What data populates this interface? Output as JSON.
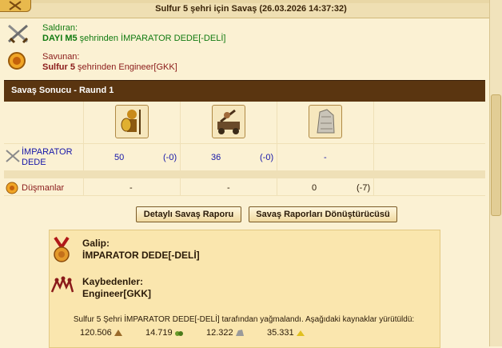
{
  "header": {
    "title": "Sulfur 5 şehri için Savaş (26.03.2026 14:37:32)"
  },
  "attacker": {
    "label": "Saldıran:",
    "name": "DAYI M5",
    "from_text": " şehrinden İMPARATOR DEDE[-DELİ]"
  },
  "defender": {
    "label": "Savunan:",
    "name": "Sulfur 5",
    "from_text": " şehrinden Engineer[GKK]"
  },
  "battle": {
    "round_title": "Savaş Sonucu - Raund 1",
    "rows": [
      {
        "name_line1": "İMPARATOR",
        "name_line2": "DEDE",
        "unit1_value": "50",
        "unit1_loss": "(-0)",
        "unit2_value": "36",
        "unit2_loss": "(-0)",
        "unit3_value": "-"
      },
      {
        "name": "Düşmanlar",
        "unit1_value": "-",
        "unit2_value": "-",
        "unit3_value": "0",
        "unit3_loss": "(-7)"
      }
    ]
  },
  "buttons": {
    "detailed_report": "Detaylı Savaş Raporu",
    "report_converter": "Savaş Raporları Dönüştürücüsü"
  },
  "outcome": {
    "winner_label": "Galip:",
    "winner_name": "İMPARATOR DEDE[-DELİ]",
    "loser_label": "Kaybedenler:",
    "loser_name": "Engineer[GKK]",
    "loot_text": "Sulfur 5 Şehri İMPARATOR DEDE[-DELİ] tarafından yağmalandı. Aşağıdaki kaynaklar yürütüldü:",
    "resources": [
      "120.506",
      "14.719",
      "12.322",
      "35.331"
    ]
  },
  "colors": {
    "accent_brown": "#5a3510",
    "attacker_green": "#107a10",
    "defender_red": "#8a1a1a",
    "number_blue": "#1616a8"
  }
}
